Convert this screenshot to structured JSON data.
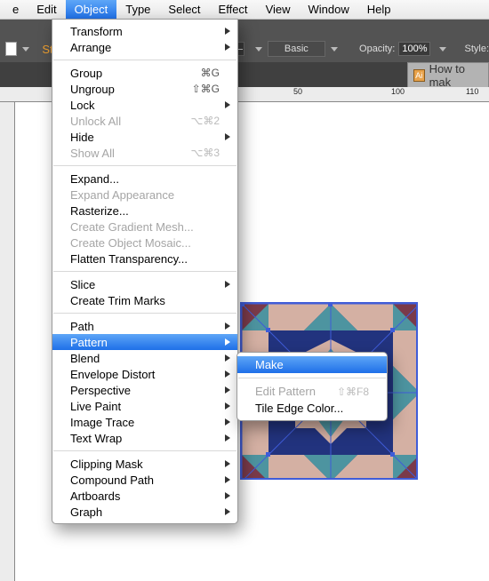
{
  "menubar": {
    "items": [
      {
        "label": "e"
      },
      {
        "label": "Edit"
      },
      {
        "label": "Object",
        "active": true
      },
      {
        "label": "Type"
      },
      {
        "label": "Select"
      },
      {
        "label": "Effect"
      },
      {
        "label": "View"
      },
      {
        "label": "Window"
      },
      {
        "label": "Help"
      }
    ]
  },
  "properties": {
    "stroke_label": "Stro",
    "brush_label": "Basic",
    "opacity_label": "Opacity:",
    "opacity_value": "100%",
    "style_label": "Style:"
  },
  "document_tab": {
    "title": "How to mak",
    "icon": "Ai"
  },
  "ruler": {
    "labels": [
      "50",
      "100",
      "110"
    ]
  },
  "menu": {
    "items": [
      {
        "label": "Transform",
        "arrow": true
      },
      {
        "label": "Arrange",
        "arrow": true
      },
      {
        "sep": true
      },
      {
        "label": "Group",
        "shortcut": "⌘G"
      },
      {
        "label": "Ungroup",
        "shortcut": "⇧⌘G"
      },
      {
        "label": "Lock",
        "arrow": true
      },
      {
        "label": "Unlock All",
        "shortcut": "⌥⌘2",
        "disabled": true
      },
      {
        "label": "Hide",
        "arrow": true
      },
      {
        "label": "Show All",
        "shortcut": "⌥⌘3",
        "disabled": true
      },
      {
        "sep": true
      },
      {
        "label": "Expand..."
      },
      {
        "label": "Expand Appearance",
        "disabled": true
      },
      {
        "label": "Rasterize..."
      },
      {
        "label": "Create Gradient Mesh...",
        "disabled": true
      },
      {
        "label": "Create Object Mosaic...",
        "disabled": true
      },
      {
        "label": "Flatten Transparency..."
      },
      {
        "sep": true
      },
      {
        "label": "Slice",
        "arrow": true
      },
      {
        "label": "Create Trim Marks"
      },
      {
        "sep": true
      },
      {
        "label": "Path",
        "arrow": true
      },
      {
        "label": "Pattern",
        "arrow": true,
        "highlight": true
      },
      {
        "label": "Blend",
        "arrow": true
      },
      {
        "label": "Envelope Distort",
        "arrow": true
      },
      {
        "label": "Perspective",
        "arrow": true
      },
      {
        "label": "Live Paint",
        "arrow": true
      },
      {
        "label": "Image Trace",
        "arrow": true
      },
      {
        "label": "Text Wrap",
        "arrow": true
      },
      {
        "sep": true
      },
      {
        "label": "Clipping Mask",
        "arrow": true
      },
      {
        "label": "Compound Path",
        "arrow": true
      },
      {
        "label": "Artboards",
        "arrow": true
      },
      {
        "label": "Graph",
        "arrow": true
      }
    ]
  },
  "submenu": {
    "items": [
      {
        "label": "Make",
        "highlight": true
      },
      {
        "sep": true
      },
      {
        "label": "Edit Pattern",
        "shortcut": "⇧⌘F8",
        "disabled": true
      },
      {
        "label": "Tile Edge Color..."
      }
    ]
  },
  "artwork": {
    "colors": {
      "navy": "#22337e",
      "teal": "#4d94a0",
      "tan": "#d4b0a3",
      "maroon": "#7a3a4a",
      "sel": "#3f5cd8"
    }
  }
}
